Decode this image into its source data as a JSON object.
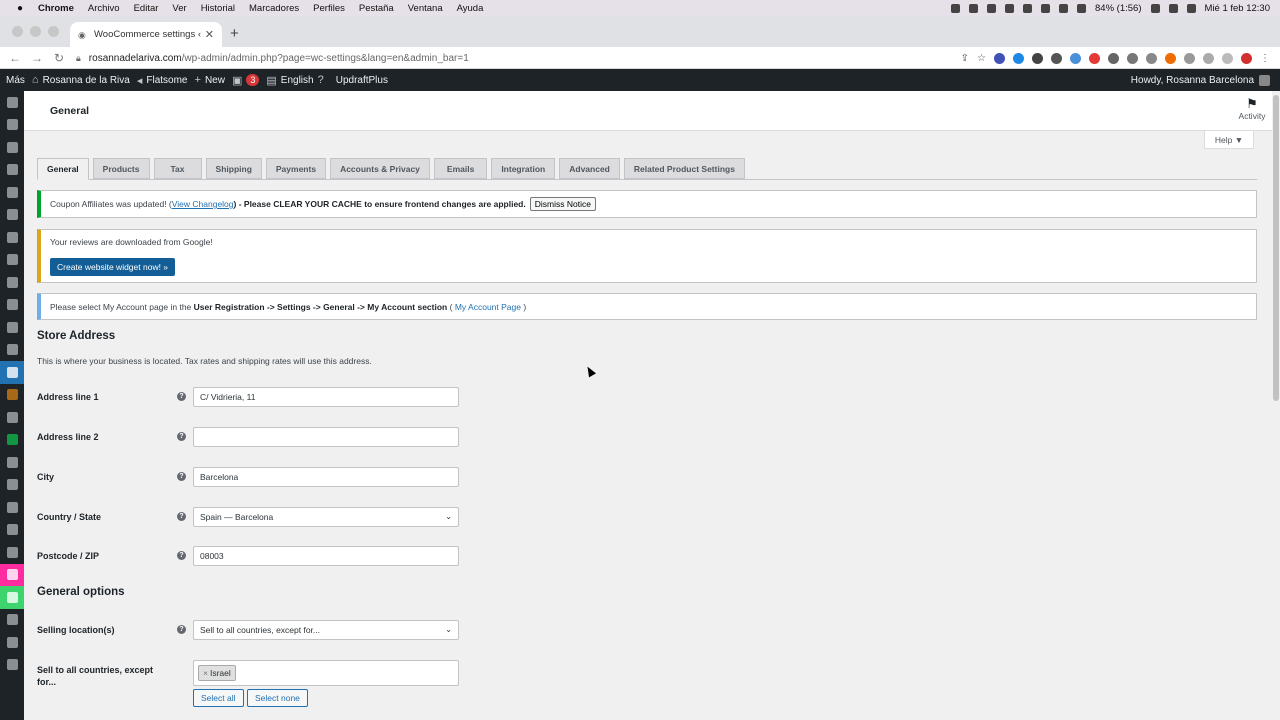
{
  "mac_menu": {
    "app": "Chrome",
    "items": [
      "Archivo",
      "Editar",
      "Ver",
      "Historial",
      "Marcadores",
      "Perfiles",
      "Pestaña",
      "Ventana",
      "Ayuda"
    ],
    "battery": "84% (1:56)",
    "datetime": "Mié 1 feb  12:30"
  },
  "browser": {
    "tab_title": "WooCommerce settings ‹ Rosanna de la Riva",
    "url_host": "rosannadelariva.com",
    "url_path": "/wp-admin/admin.php?page=wc-settings&lang=en&admin_bar=1"
  },
  "adminbar": {
    "more": "Más",
    "site": "Rosanna de la Riva",
    "theme": "Flatsome",
    "new": "New",
    "updates_count": "3",
    "language": "English",
    "updraft": "UpdraftPlus",
    "howdy": "Howdy, Rosanna Barcelona"
  },
  "header": {
    "title": "General",
    "activity": "Activity",
    "help": "Help ▼"
  },
  "tabs": [
    "General",
    "Products",
    "Tax",
    "Shipping",
    "Payments",
    "Accounts & Privacy",
    "Emails",
    "Integration",
    "Advanced",
    "Related Product Settings"
  ],
  "notices": {
    "coupon_pre": "Coupon Affiliates was updated! (",
    "coupon_link": "View Changelog",
    "coupon_post": ") - Please CLEAR YOUR CACHE to ensure frontend changes are applied.",
    "dismiss": "Dismiss Notice",
    "reviews_text": "Your reviews are downloaded from Google!",
    "reviews_button": "Create website widget now! »",
    "account_pre": "Please select My Account page in the",
    "account_bold": "User Registration -> Settings -> General -> My Account section",
    "account_paren_open": "(",
    "account_link": "My Account Page",
    "account_paren_close": ")"
  },
  "store_address": {
    "heading": "Store Address",
    "description": "This is where your business is located. Tax rates and shipping rates will use this address.",
    "fields": [
      {
        "label": "Address line 1",
        "value": "C/ Vidrieria, 11"
      },
      {
        "label": "Address line 2",
        "value": ""
      },
      {
        "label": "City",
        "value": "Barcelona"
      },
      {
        "label": "Country / State",
        "value": "Spain — Barcelona"
      },
      {
        "label": "Postcode / ZIP",
        "value": "08003"
      }
    ]
  },
  "general_options": {
    "heading": "General options",
    "selling_label": "Selling location(s)",
    "selling_value": "Sell to all countries, except for...",
    "except_label": "Sell to all countries, except for...",
    "except_chip": "Israel",
    "select_all": "Select all",
    "select_none": "Select none"
  }
}
